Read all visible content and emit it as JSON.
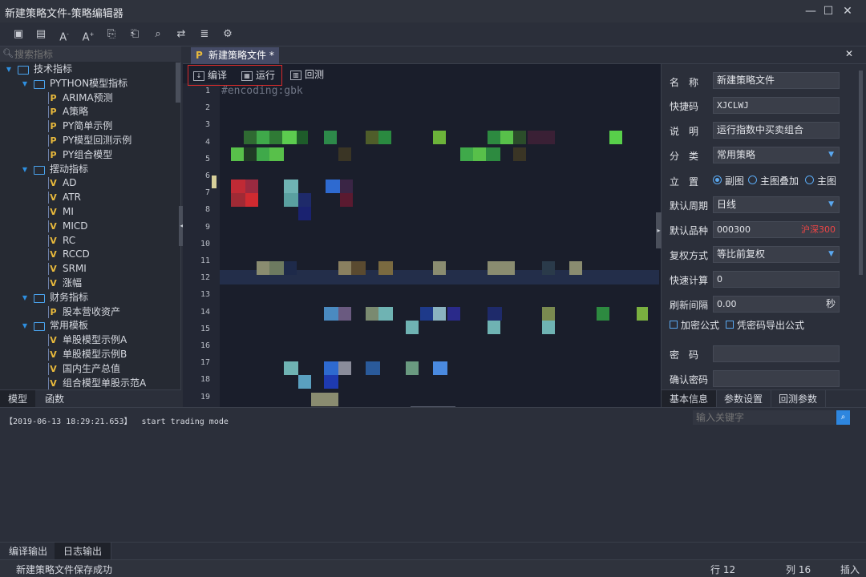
{
  "window": {
    "title": "新建策略文件-策略编辑器",
    "controls": [
      "minimize",
      "maximize",
      "close"
    ]
  },
  "toolbar": {
    "icons": [
      "save-icon",
      "save-all-icon",
      "font-decrease-icon",
      "font-increase-icon",
      "import-icon",
      "export-icon",
      "find-icon",
      "format-icon",
      "settings-doc-icon",
      "options-icon"
    ]
  },
  "left_panel": {
    "search_placeholder": "搜索指标",
    "tree": [
      {
        "level": 0,
        "type": "folder",
        "label": "技术指标"
      },
      {
        "level": 1,
        "type": "folder",
        "label": "PYTHON模型指标"
      },
      {
        "level": 2,
        "type": "file",
        "icon": "P",
        "label": "ARIMA预测"
      },
      {
        "level": 2,
        "type": "file",
        "icon": "P",
        "label": "A策略"
      },
      {
        "level": 2,
        "type": "file",
        "icon": "P",
        "label": "PY简单示例"
      },
      {
        "level": 2,
        "type": "file",
        "icon": "P",
        "label": "PY模型回测示例"
      },
      {
        "level": 2,
        "type": "file",
        "icon": "P",
        "label": "PY组合模型"
      },
      {
        "level": 1,
        "type": "folder",
        "label": "摆动指标"
      },
      {
        "level": 2,
        "type": "file",
        "icon": "V",
        "label": "AD"
      },
      {
        "level": 2,
        "type": "file",
        "icon": "V",
        "label": "ATR"
      },
      {
        "level": 2,
        "type": "file",
        "icon": "V",
        "label": "MI"
      },
      {
        "level": 2,
        "type": "file",
        "icon": "V",
        "label": "MICD"
      },
      {
        "level": 2,
        "type": "file",
        "icon": "V",
        "label": "RC"
      },
      {
        "level": 2,
        "type": "file",
        "icon": "V",
        "label": "RCCD"
      },
      {
        "level": 2,
        "type": "file",
        "icon": "V",
        "label": "SRMI"
      },
      {
        "level": 2,
        "type": "file",
        "icon": "V",
        "label": "涨幅"
      },
      {
        "level": 1,
        "type": "folder",
        "label": "财务指标"
      },
      {
        "level": 2,
        "type": "file",
        "icon": "P",
        "label": "股本营收资产"
      },
      {
        "level": 1,
        "type": "folder",
        "label": "常用模板"
      },
      {
        "level": 2,
        "type": "file",
        "icon": "V",
        "label": "单股模型示例A"
      },
      {
        "level": 2,
        "type": "file",
        "icon": "V",
        "label": "单股模型示例B"
      },
      {
        "level": 2,
        "type": "file",
        "icon": "V",
        "label": "国内生产总值"
      },
      {
        "level": 2,
        "type": "file",
        "icon": "V",
        "label": "组合模型单股示范A"
      }
    ],
    "tabs": [
      "模型",
      "函数"
    ]
  },
  "editor": {
    "file_tab": "新建策略文件 *",
    "tools": {
      "compile": "编译",
      "run": "运行",
      "backtest": "回测"
    },
    "first_line": "#encoding:gbk",
    "line_numbers": [
      "1",
      "2",
      "3",
      "4",
      "5",
      "6",
      "7",
      "8",
      "9",
      "10",
      "11",
      "12",
      "13",
      "14",
      "15",
      "16",
      "17",
      "18",
      "19"
    ]
  },
  "right_panel": {
    "name_label": "名　称",
    "name_value": "新建策略文件",
    "shortcut_label": "快捷码",
    "shortcut_value": "XJCLWJ",
    "desc_label": "说　明",
    "desc_value": "运行指数中买卖组合",
    "category_label": "分　类",
    "category_value": "常用策略",
    "position_label": "立　置",
    "position_options": [
      "副图",
      "主图叠加",
      "主图"
    ],
    "period_label": "默认周期",
    "period_value": "日线",
    "variety_label": "默认品种",
    "variety_value": "000300",
    "variety_name": "沪深300",
    "adjust_label": "复权方式",
    "adjust_value": "等比前复权",
    "fastcalc_label": "快速计算",
    "fastcalc_value": "0",
    "refresh_label": "刷新间隔",
    "refresh_value": "0.00",
    "refresh_unit": "秒",
    "encrypt_label": "加密公式",
    "export_label": "凭密码导出公式",
    "password_label": "密　码",
    "confirm_label": "确认密码",
    "tabs": [
      "基本信息",
      "参数设置",
      "回测参数"
    ]
  },
  "output": {
    "search_placeholder": "输入关键字",
    "log": "【2019-06-13 18:29:21.653】  start trading mode",
    "tabs": [
      "编译输出",
      "日志输出"
    ]
  },
  "status": {
    "message": "新建策略文件保存成功",
    "row": "行 12",
    "col": "列 16",
    "mode": "插入"
  },
  "colors": {
    "accent": "#2e86de",
    "highlight_border": "#d82b2b",
    "variety_red": "#f04545"
  }
}
